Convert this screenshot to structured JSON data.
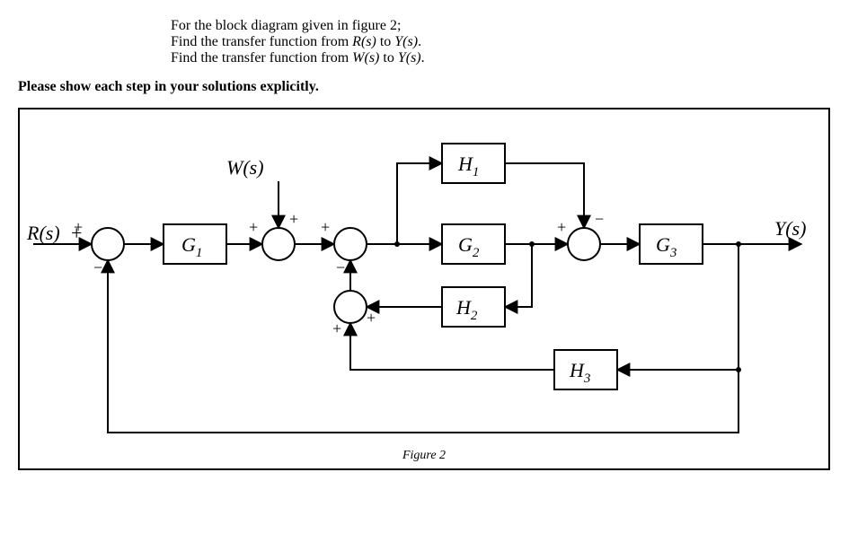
{
  "text": {
    "line1": "For the block diagram given in figure 2;",
    "line2_a": "Find the transfer function from ",
    "line2_b": " to ",
    "line2_c": ".",
    "line3_a": "Find the transfer function from ",
    "line3_b": " to ",
    "line3_c": ".",
    "instruct": "Please show each step in your solutions explicitly.",
    "caption": "Figure 2"
  },
  "sym": {
    "R": "R(s)",
    "W": "W(s)",
    "Y": "Y(s)",
    "G1": "G",
    "G1s": "1",
    "G2": "G",
    "G2s": "2",
    "G3": "G",
    "G3s": "3",
    "H1": "H",
    "H1s": "1",
    "H2": "H",
    "H2s": "2",
    "H3": "H",
    "H3s": "3",
    "plus": "+",
    "minus": "−"
  }
}
